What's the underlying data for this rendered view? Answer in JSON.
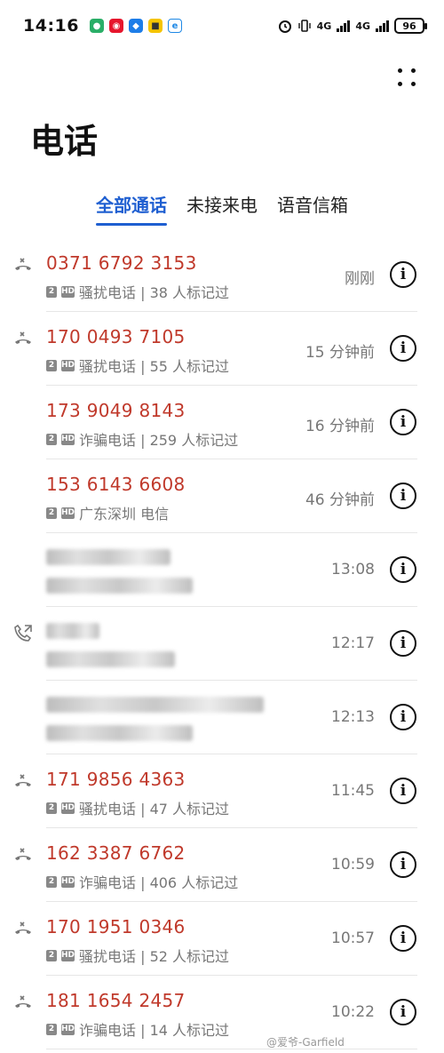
{
  "status_bar": {
    "time": "14:16",
    "network_1": "4G",
    "network_2": "4G",
    "battery": "96"
  },
  "page_title": "电话",
  "tabs": [
    {
      "label": "全部通话",
      "active": true
    },
    {
      "label": "未接来电",
      "active": false
    },
    {
      "label": "语音信箱",
      "active": false
    }
  ],
  "calls": [
    {
      "number": "0371 6792 3153",
      "sub": "骚扰电话 | 38 人标记过",
      "time": "刚刚",
      "type": "rejected",
      "badges": true
    },
    {
      "number": "170 0493 7105",
      "sub": "骚扰电话 | 55 人标记过",
      "time": "15 分钟前",
      "type": "rejected",
      "badges": true
    },
    {
      "number": "173 9049 8143",
      "sub": "诈骗电话 | 259 人标记过",
      "time": "16 分钟前",
      "type": "none",
      "badges": true
    },
    {
      "number": "153 6143 6608",
      "sub": "广东深圳 电信",
      "time": "46 分钟前",
      "type": "none",
      "badges": true
    },
    {
      "number": "",
      "sub": "",
      "time": "13:08",
      "type": "none",
      "badges": false,
      "blurred": true
    },
    {
      "number": "",
      "sub": "",
      "time": "12:17",
      "type": "outgoing",
      "badges": false,
      "blurred": true
    },
    {
      "number": "",
      "sub": "",
      "time": "12:13",
      "type": "none",
      "badges": false,
      "blurred": true
    },
    {
      "number": "171 9856 4363",
      "sub": "骚扰电话 | 47 人标记过",
      "time": "11:45",
      "type": "rejected",
      "badges": true
    },
    {
      "number": "162 3387 6762",
      "sub": "诈骗电话 | 406 人标记过",
      "time": "10:59",
      "type": "rejected",
      "badges": true
    },
    {
      "number": "170 1951 0346",
      "sub": "骚扰电话 | 52 人标记过",
      "time": "10:57",
      "type": "rejected",
      "badges": true
    },
    {
      "number": "181 1654 2457",
      "sub": "诈骗电话 | 14 人标记过",
      "time": "10:22",
      "type": "rejected",
      "badges": true
    }
  ],
  "badges": {
    "sim": "2",
    "hd": "HD"
  },
  "info_glyph": "i",
  "watermark": "@爱爷-Garfield",
  "colors": {
    "accent": "#1f5fd1",
    "spam_number": "#c0392b",
    "secondary_text": "#777777"
  }
}
